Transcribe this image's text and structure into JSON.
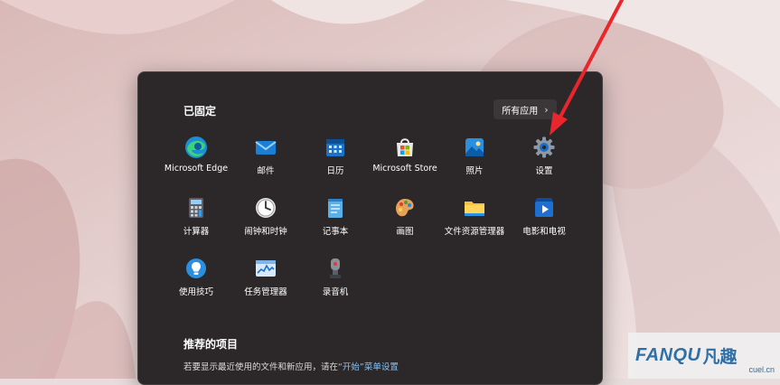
{
  "start_menu": {
    "pinned_title": "已固定",
    "all_apps_label": "所有应用",
    "apps": [
      {
        "label": "Microsoft Edge",
        "icon": "edge-icon"
      },
      {
        "label": "邮件",
        "icon": "mail-icon"
      },
      {
        "label": "日历",
        "icon": "calendar-icon"
      },
      {
        "label": "Microsoft Store",
        "icon": "store-icon"
      },
      {
        "label": "照片",
        "icon": "photos-icon"
      },
      {
        "label": "设置",
        "icon": "gear-icon"
      },
      {
        "label": "计算器",
        "icon": "calculator-icon"
      },
      {
        "label": "闹钟和时钟",
        "icon": "clock-icon"
      },
      {
        "label": "记事本",
        "icon": "notepad-icon"
      },
      {
        "label": "画图",
        "icon": "paint-icon"
      },
      {
        "label": "文件资源管理器",
        "icon": "folder-icon"
      },
      {
        "label": "电影和电视",
        "icon": "movies-icon"
      },
      {
        "label": "使用技巧",
        "icon": "tips-icon"
      },
      {
        "label": "任务管理器",
        "icon": "task-manager-icon"
      },
      {
        "label": "录音机",
        "icon": "recorder-icon"
      }
    ],
    "recommended_title": "推荐的项目",
    "recommended_text_before": "若要显示最近使用的文件和新应用，请在",
    "recommended_link": "“开始”菜单设置"
  },
  "watermark": {
    "brand": "FANQU",
    "brand_cn": "凡趣",
    "url": "cuel.cn"
  },
  "colors": {
    "menu_bg": "#2c2829",
    "annotation_arrow": "#e8262c",
    "link": "#7cc4ff"
  }
}
